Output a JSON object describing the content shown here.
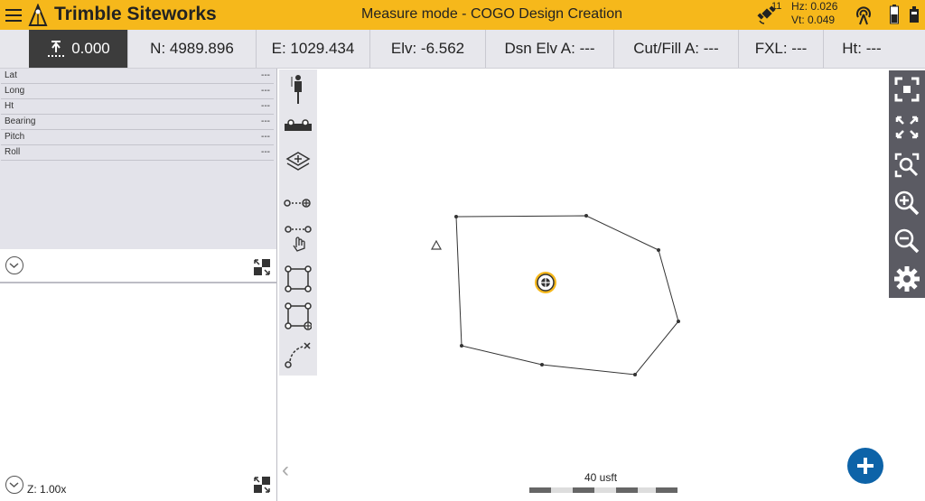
{
  "app": {
    "name": "Trimble Siteworks",
    "mode_title": "Measure mode - COGO Design Creation",
    "brand_color": "#f6b81b",
    "satellites": "11",
    "hz": "Hz: 0.026",
    "vt": "Vt: 0.049"
  },
  "status": {
    "height": "0.000",
    "n": "N: 4989.896",
    "e": "E: 1029.434",
    "elv": "Elv: -6.562",
    "dsn_elv": "Dsn Elv A: ---",
    "cut_fill": "Cut/Fill A: ---",
    "fxl": "FXL: ---",
    "ht": "Ht: ---"
  },
  "info_rows": [
    {
      "label": "Lat",
      "value": "---"
    },
    {
      "label": "Long",
      "value": "---"
    },
    {
      "label": "Ht",
      "value": "---"
    },
    {
      "label": "Bearing",
      "value": "---"
    },
    {
      "label": "Pitch",
      "value": "---"
    },
    {
      "label": "Roll",
      "value": "---"
    }
  ],
  "zoom_label": "Z: 1.00x",
  "scale_label": "40 usft",
  "icons": {
    "left_tools": [
      "pole-icon",
      "level-icon",
      "layers-icon",
      "line-point-icon",
      "select-points-icon",
      "rectangle-icon",
      "rectangle-add-icon",
      "arc-icon"
    ],
    "right_tools": [
      "zoom-extents-icon",
      "expand-icon",
      "zoom-window-icon",
      "zoom-in-icon",
      "zoom-out-icon",
      "settings-icon"
    ]
  }
}
